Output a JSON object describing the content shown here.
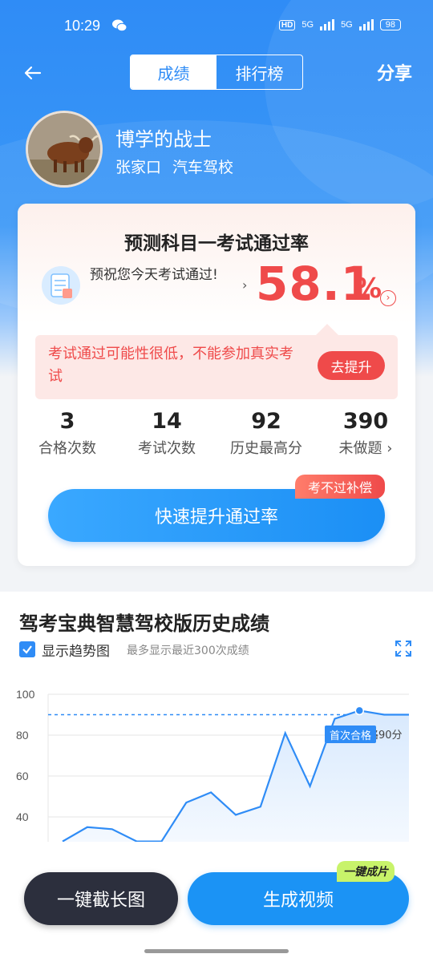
{
  "status": {
    "time": "10:29",
    "hd": "HD",
    "signal1": "5G",
    "signal2": "5G",
    "battery": "98"
  },
  "nav": {
    "tabs": [
      {
        "label": "成绩",
        "active": true
      },
      {
        "label": "排行榜",
        "active": false
      }
    ],
    "share": "分享"
  },
  "profile": {
    "name": "博学的战士",
    "city": "张家口",
    "school": "汽车驾校"
  },
  "prediction": {
    "title": "预测科目一考试通过率",
    "wish": "预祝您今天考试通过!",
    "rate": "58.1",
    "percent": "%",
    "warning": "考试通过可能性很低，不能参加真实考试",
    "improve_button": "去提升"
  },
  "stats": [
    {
      "value": "3",
      "label": "合格次数"
    },
    {
      "value": "14",
      "label": "考试次数"
    },
    {
      "value": "92",
      "label": "历史最高分"
    },
    {
      "value": "390",
      "label": "未做题"
    }
  ],
  "compensation_badge": "考不过补偿",
  "boost_button": "快速提升通过率",
  "history": {
    "title": "驾考宝典智慧驾校版历史成绩",
    "show_trend": "显示趋势图",
    "note": "最多显示最近300次成绩",
    "first_pass": "首次合格",
    "pass_line_label": "合格90分"
  },
  "chart_data": {
    "type": "line",
    "y_ticks": [
      "100",
      "80",
      "60",
      "40"
    ],
    "ylim": [
      30,
      100
    ],
    "pass_line": 90,
    "values": [
      28,
      35,
      34,
      28,
      28,
      47,
      52,
      41,
      45,
      81,
      55,
      88,
      92,
      90,
      90
    ],
    "first_pass_index": 12,
    "colors": {
      "line": "#2f8cf6",
      "pass_line": "#2f8cf6"
    }
  },
  "bottom": {
    "long_screenshot": "一键截长图",
    "generate_video": "生成视频",
    "video_badge": "一键成片"
  }
}
